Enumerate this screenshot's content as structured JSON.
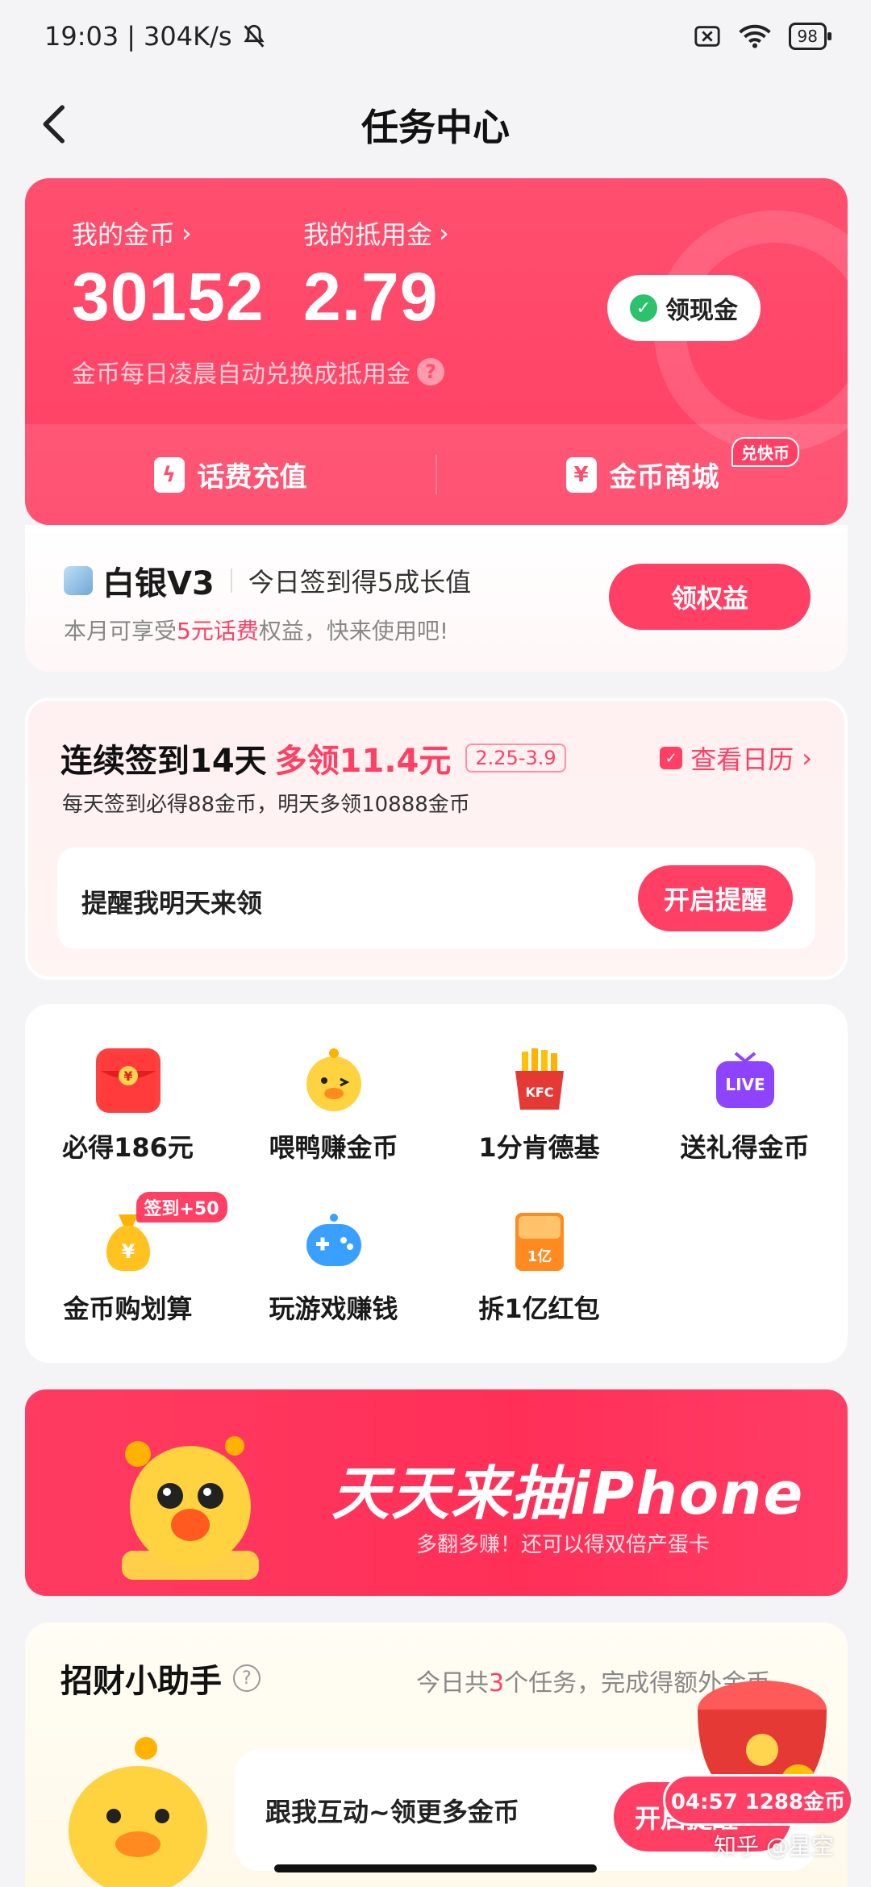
{
  "status": {
    "time": "19:03",
    "speed": "304K/s",
    "battery": "98"
  },
  "nav": {
    "title": "任务中心"
  },
  "wallet": {
    "coins_label": "我的金币",
    "coins_value": "30152",
    "deduct_label": "我的抵用金",
    "deduct_value": "2.79",
    "cash_button": "领现金",
    "note": "金币每日凌晨自动兑换成抵用金",
    "actions": [
      {
        "label": "话费充值",
        "icon": "lightning-icon"
      },
      {
        "label": "金币商城",
        "icon": "yen-ticket-icon",
        "badge": "兑快币"
      }
    ]
  },
  "member": {
    "tier": "白银V3",
    "tip": "今日签到得5成长值",
    "desc_prefix": "本月可享受",
    "desc_highlight": "5元话费",
    "desc_suffix": "权益，快来使用吧!",
    "button": "领权益"
  },
  "checkin": {
    "title_main": "连续签到14天",
    "title_red": "多领11.4元",
    "date_range": "2.25-3.9",
    "calendar_link": "查看日历",
    "subtitle": "每天签到必得88金币，明天多领10888金币",
    "reminder_text": "提醒我明天来领",
    "reminder_button": "开启提醒"
  },
  "grid": [
    {
      "label": "必得186元",
      "icon": "red-envelope-icon"
    },
    {
      "label": "喂鸭赚金币",
      "icon": "duck-icon"
    },
    {
      "label": "1分肯德基",
      "icon": "kfc-fries-icon",
      "icon_text": "KFC"
    },
    {
      "label": "送礼得金币",
      "icon": "live-tv-icon",
      "icon_text": "LIVE"
    },
    {
      "label": "金币购划算",
      "icon": "money-bag-icon",
      "badge": "签到+50"
    },
    {
      "label": "玩游戏赚钱",
      "icon": "gamepad-icon"
    },
    {
      "label": "拆1亿红包",
      "icon": "red-packet-icon",
      "icon_text": "1亿"
    }
  ],
  "banner": {
    "title": "天天来抽iPhone",
    "subtitle": "多翻多赚！还可以得双倍产蛋卡"
  },
  "assistant": {
    "title": "招财小助手",
    "right_prefix": "今日共",
    "right_count": "3",
    "right_suffix": "个任务，完成得额外金币",
    "bubble_text": "跟我互动~领更多金币",
    "button": "开启提醒"
  },
  "floating": {
    "timer": "04:57 1288金币"
  },
  "watermark": "知乎 @星空",
  "colors": {
    "brand": "#ff3f64",
    "wechat_green": "#2cc16b"
  }
}
